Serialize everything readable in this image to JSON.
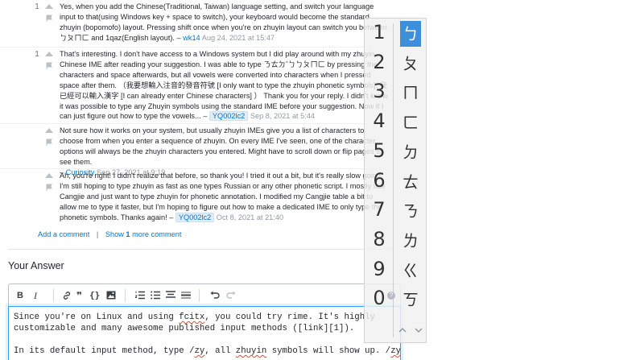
{
  "comments": [
    {
      "score": "1",
      "text": "Yes, when you add the Chinese(Traditional, Taiwan) language setting, and switch your language input to that(using Windows key + space to switch), your keyboard would become the standard zhuyin (bopomofo) layout. Pressing shift once when you're on zhuyin layout can switch you between ㄅㄆㄇㄈ and 1qaz(English layout).",
      "user": "wk14",
      "date": "Aug 24, 2021 at 15:47",
      "badge": false
    },
    {
      "score": "1",
      "text": "That's interesting. I don't have access to a Windows system but I did play around with my zhuyin Chinese IME after reading your suggestion. I was able to type ㄋㄊㄉˇㄅㄅㄆㄇㄈ by pressing the characters and space afterwards, but all vowels were converted into characters when I pressed space after them. （我要想輸入注音的發音符號 [I only want to type the zhuyin phonetic symbols]. 我已經可以輸入漢字 [I can already enter Chinese characters] ） Thank you for your reply. I didn't know it was possible to type any Zhuyin symbols using the standard IME before your suggestion. Now if I can just figure out how to type the vowels...",
      "user": "YQ002lc2",
      "date": "Sep 8, 2021 at 5:44",
      "badge": true
    },
    {
      "score": "",
      "text": "Not sure how it works on your system, but usually zhuyin IMEs give you a list of characters to choose from when you enter a sequence of zhuyin. On every IME I've seen, one of the character options will always be the zhuyin characters you entered. Might have to scroll down or flip pages to see them.",
      "user": "Curiosity",
      "date": "Sep 27, 2021 at 9:19",
      "badge": false
    },
    {
      "score": "",
      "text": "Ah, you're right! I didn't realize that before, so thank you! I tried it out a bit, but it's really slow going. I'm still hoping to type zhuyin as fast as one types Russian or any other phonetic script. I mostly use Cangjie and just want to type zhuyin for phonetic annotation. I modified my Cangjie table a bit to allow me to type it faster, but I'm hoping to figure out how to make a dedicated IME to only type the phonetic symbols. Thanks again!",
      "user": "YQ002lc2",
      "date": "Oct 8, 2021 at 21:40",
      "badge": true
    }
  ],
  "comment_links": {
    "add": "Add a comment",
    "sep": "|",
    "show_prefix": "Show",
    "show_count": "1",
    "show_suffix": "more comment"
  },
  "answer": {
    "heading": "Your Answer",
    "toolbar": [
      "bold-icon",
      "italic-icon",
      "link-icon",
      "quote-icon",
      "code-icon",
      "image-icon",
      "ordered-list-icon",
      "unordered-list-icon",
      "heading-icon",
      "horizontal-rule-icon",
      "undo-icon",
      "redo-icon"
    ],
    "editor_lines": [
      "Since you're on Linux and using fcitx, you could try rime. It's highly",
      "customizable and many awesome published input methods ([link][1]).",
      "",
      "In its default input method, type /zy, all zhuyin symbols will show up. /zy"
    ]
  },
  "ime": {
    "numbers": [
      "1",
      "2",
      "3",
      "4",
      "5",
      "6",
      "7",
      "8",
      "9",
      "0"
    ],
    "candidates": [
      "ㄅ",
      "ㄆ",
      "ㄇ",
      "ㄈ",
      "ㄉ",
      "ㄊ",
      "ㄋ",
      "ㄌ",
      "ㄍ",
      "ㄎ"
    ],
    "selected_index": 0,
    "help": "?",
    "prev": "^",
    "next": "v",
    "accent_color": "#3d8fdc"
  }
}
